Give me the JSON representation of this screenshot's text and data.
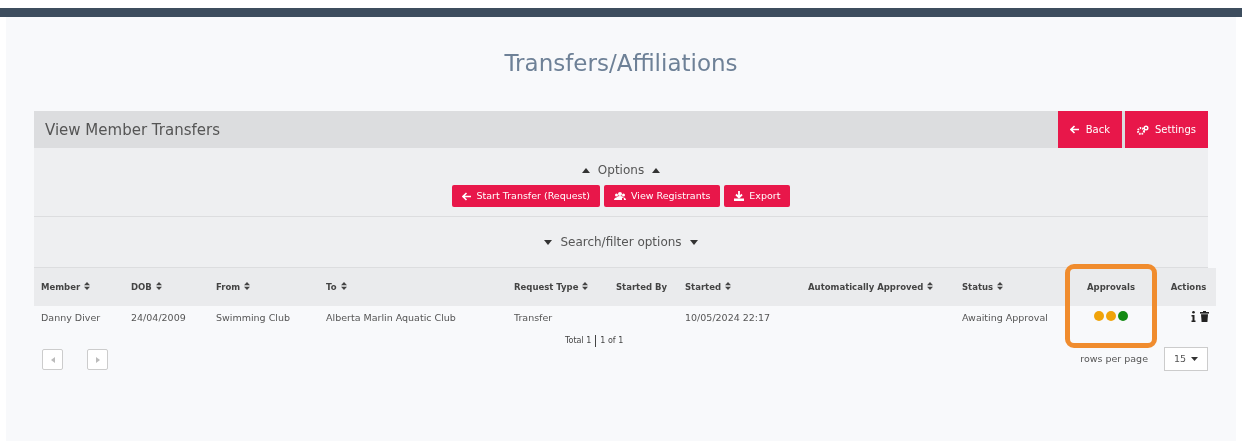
{
  "page_title": "Transfers/Affiliations",
  "panel": {
    "title": "View Member Transfers",
    "header_buttons": [
      {
        "label": "Back"
      },
      {
        "label": "Settings"
      }
    ],
    "options_label": "Options",
    "options_buttons": [
      {
        "label": "Start Transfer (Request)"
      },
      {
        "label": "View Registrants"
      },
      {
        "label": "Export"
      }
    ],
    "filter_label": "Search/filter options"
  },
  "table": {
    "columns": [
      {
        "label": "Member",
        "sortable": true,
        "highlighted": false
      },
      {
        "label": "DOB",
        "sortable": true,
        "highlighted": false
      },
      {
        "label": "From",
        "sortable": true,
        "highlighted": false
      },
      {
        "label": "To",
        "sortable": true,
        "highlighted": false
      },
      {
        "label": "Request Type",
        "sortable": true,
        "highlighted": false
      },
      {
        "label": "Started By",
        "sortable": false,
        "highlighted": false
      },
      {
        "label": "Started",
        "sortable": true,
        "highlighted": false
      },
      {
        "label": "Automatically Approved",
        "sortable": true,
        "highlighted": false
      },
      {
        "label": "Status",
        "sortable": true,
        "highlighted": false
      },
      {
        "label": "Approvals",
        "sortable": false,
        "highlighted": true
      },
      {
        "label": "Actions",
        "sortable": false,
        "highlighted": false
      }
    ],
    "rows": [
      {
        "cells": [
          "Danny Diver",
          "24/04/2009",
          "Swimming Club",
          "Alberta Marlin Aquatic Club",
          "Transfer",
          "",
          "10/05/2024 22:17",
          "",
          "Awaiting Approval"
        ],
        "approvals": [
          {
            "color": "#f0a30a"
          },
          {
            "color": "#f0a30a"
          },
          {
            "color": "#138a13"
          }
        ]
      }
    ]
  },
  "pagination": {
    "total": "Total 1",
    "pages": "1 of 1",
    "rows_per_page_label": "rows per page",
    "rows_per_page": "15"
  }
}
